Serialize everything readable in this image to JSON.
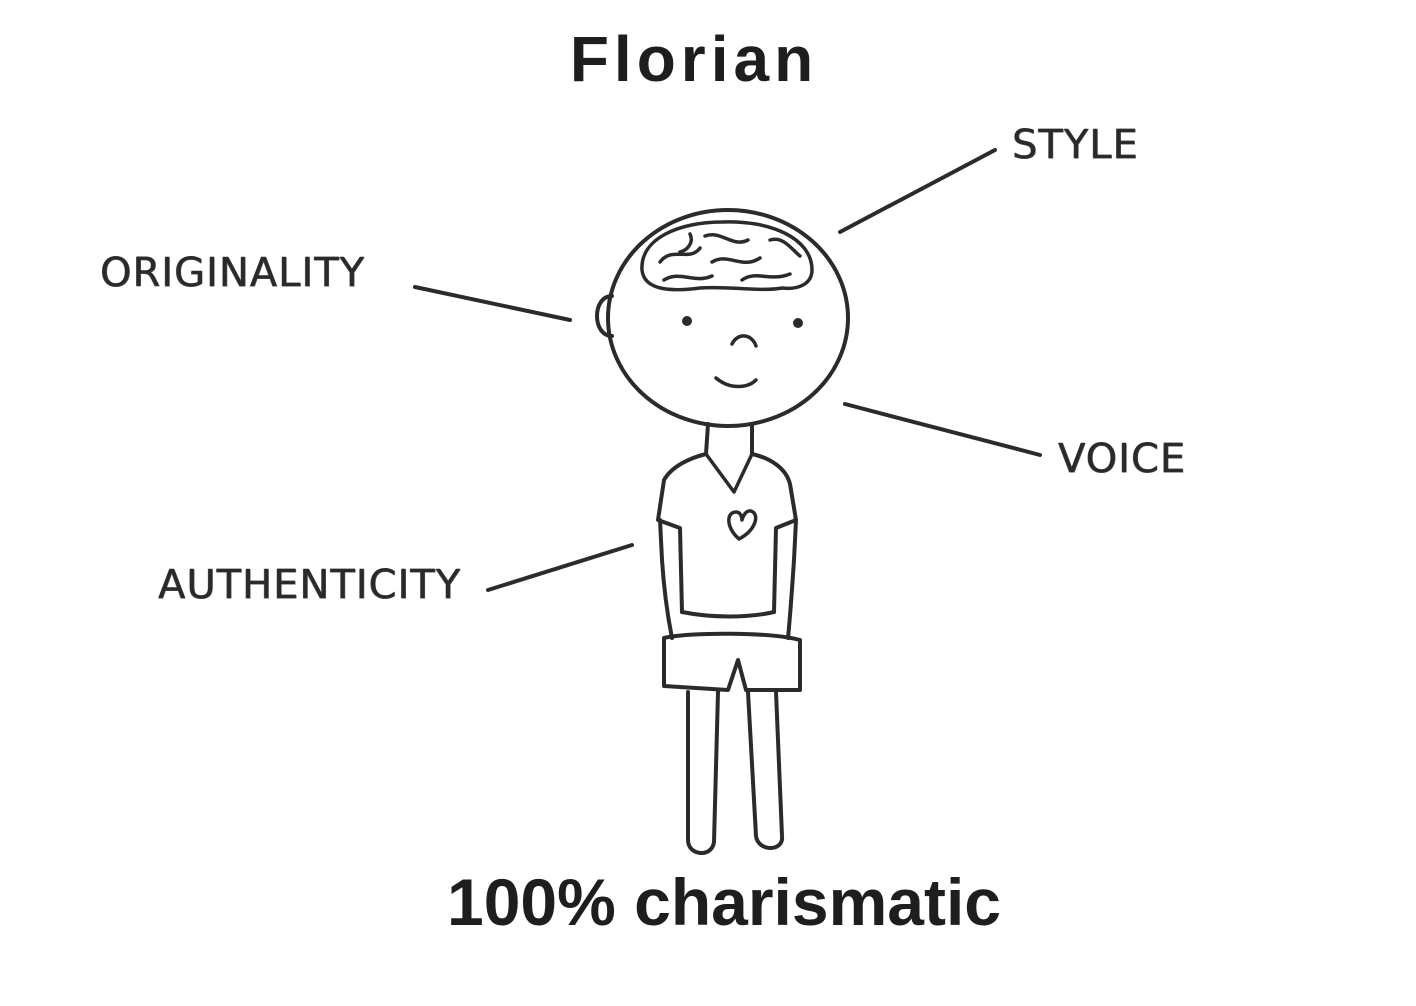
{
  "header": {
    "name": "Florian"
  },
  "labels": {
    "style": "STYLE",
    "originality": "ORIGINALITY",
    "voice": "VOICE",
    "authenticity": "AUTHENTICITY"
  },
  "footer": {
    "caption": "100% charismatic"
  },
  "colors": {
    "ink": "#2a2a2a",
    "title": "#1e1e1e",
    "background": "#ffffff"
  },
  "icons": {
    "figure": "stick-figure-boy",
    "brain": "brain-icon",
    "heart": "heart-icon"
  }
}
